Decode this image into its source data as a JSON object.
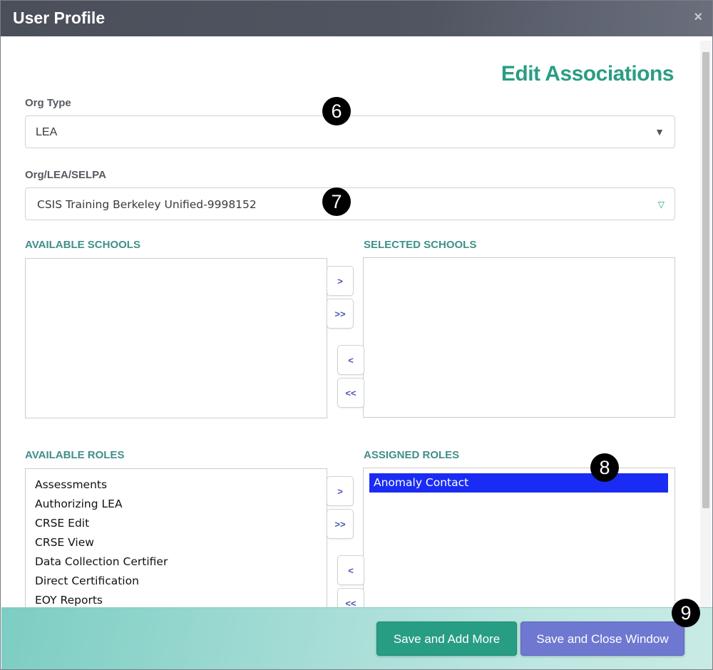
{
  "window": {
    "title": "User Profile",
    "close_glyph": "×"
  },
  "heading": "Edit Associations",
  "org_type": {
    "label": "Org Type",
    "value": "LEA",
    "caret": "▼"
  },
  "org": {
    "label": "Org/LEA/SELPA",
    "value": "CSIS Training Berkeley Unified-9998152",
    "caret": "▽"
  },
  "schools": {
    "available_label": "AVAILABLE SCHOOLS",
    "selected_label": "SELECTED SCHOOLS",
    "available": [],
    "selected": [],
    "buttons": {
      "add": ">",
      "add_all": ">>",
      "remove": "<",
      "remove_all": "<<"
    }
  },
  "roles": {
    "available_label": "AVAILABLE ROLES",
    "assigned_label": "ASSIGNED ROLES",
    "available": [
      "Assessments",
      "Authorizing LEA",
      "CRSE Edit",
      "CRSE View",
      "Data Collection Certifier",
      "Direct Certification",
      "EOY Reports"
    ],
    "assigned": [
      "Anomaly Contact"
    ],
    "buttons": {
      "add": ">",
      "add_all": ">>",
      "remove": "<",
      "remove_all": "<<"
    }
  },
  "badges": {
    "b6": "6",
    "b7": "7",
    "b8": "8",
    "b9": "9"
  },
  "footer": {
    "save_add_label": "Save and Add More",
    "save_close_label": "Save and Close Window"
  },
  "colors": {
    "accent_teal": "#2a9d84",
    "selected_blue": "#1a2cf4",
    "button_purple": "#6e78d0",
    "button_green": "#279d84"
  }
}
